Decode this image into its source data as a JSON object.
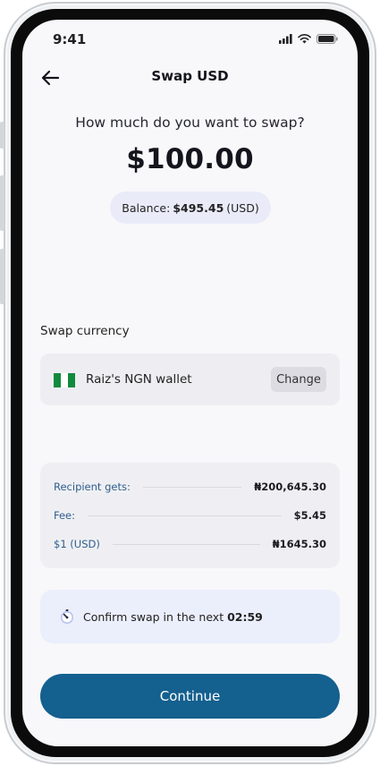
{
  "status_bar": {
    "time": "9:41"
  },
  "header": {
    "title": "Swap USD"
  },
  "swap": {
    "question": "How much do you want to swap?",
    "amount": "$100.00",
    "balance_label": "Balance:",
    "balance_value": "$495.45",
    "balance_currency": "(USD)"
  },
  "swap_currency": {
    "label": "Swap currency",
    "wallet_name": "Raiz's NGN wallet",
    "change_label": "Change",
    "flag_colors": [
      "#118a3e",
      "#ffffff",
      "#118a3e"
    ]
  },
  "summary": {
    "rows": [
      {
        "label": "Recipient gets:",
        "value": "₦200,645.30"
      },
      {
        "label": "Fee:",
        "value": "$5.45"
      },
      {
        "label": "$1 (USD)",
        "value": "₦1645.30"
      }
    ]
  },
  "timer": {
    "text": "Confirm swap in the next",
    "countdown": "02:59"
  },
  "actions": {
    "continue_label": "Continue"
  },
  "colors": {
    "primary": "#14608f",
    "pill_bg": "#e9ecf8",
    "label_blue": "#2f5e8c"
  },
  "icons": {
    "back": "arrow-left-icon",
    "timer": "stopwatch-icon",
    "signal": "cellular-signal-icon",
    "wifi": "wifi-icon",
    "battery": "battery-icon"
  }
}
